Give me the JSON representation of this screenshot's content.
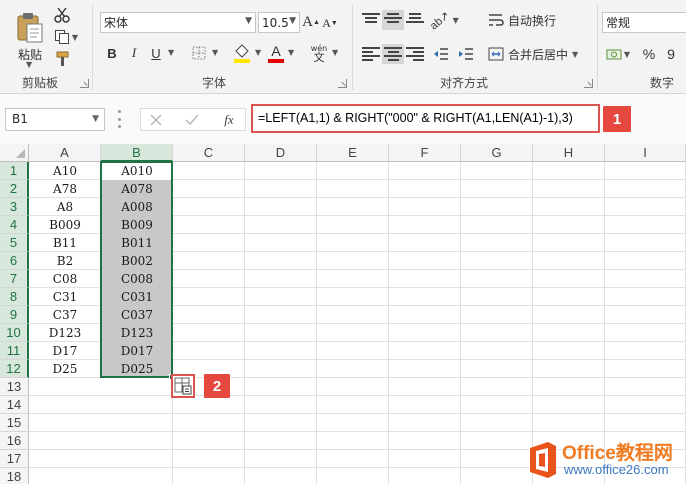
{
  "ribbon": {
    "clipboard": {
      "paste_label": "粘贴",
      "group_label": "剪贴板"
    },
    "font": {
      "name": "宋体",
      "size": "10.5",
      "bold": "B",
      "italic": "I",
      "underline": "U",
      "grow": "A",
      "shrink": "A",
      "group_label": "字体",
      "phonetic": "wén"
    },
    "alignment": {
      "wrap_text": "自动换行",
      "merge_center": "合并后居中",
      "group_label": "对齐方式"
    },
    "number": {
      "format": "常规",
      "percent": "%",
      "comma": "9",
      "group_label": "数字"
    }
  },
  "formula_bar": {
    "name_box": "B1",
    "fx": "fx",
    "formula": "=LEFT(A1,1) & RIGHT(\"000\" & RIGHT(A1,LEN(A1)-1),3)",
    "badge_1": "1"
  },
  "grid": {
    "columns": [
      "A",
      "B",
      "C",
      "D",
      "E",
      "F",
      "G",
      "H",
      "I"
    ],
    "rows": [
      "1",
      "2",
      "3",
      "4",
      "5",
      "6",
      "7",
      "8",
      "9",
      "10",
      "11",
      "12",
      "13",
      "14",
      "15",
      "16",
      "17",
      "18"
    ],
    "col_a": [
      "A10",
      "A78",
      "A8",
      "B009",
      "B11",
      "B2",
      "C08",
      "C31",
      "C37",
      "D123",
      "D17",
      "D25"
    ],
    "col_b": [
      "A010",
      "A078",
      "A008",
      "B009",
      "B011",
      "B002",
      "C008",
      "C031",
      "C037",
      "D123",
      "D017",
      "D025"
    ],
    "badge_2": "2"
  },
  "watermark": {
    "brand": "Office教程网",
    "url": "www.office26.com"
  },
  "colors": {
    "accent_green": "#217346",
    "badge_red": "#e5483f",
    "selection_gray": "#c8c8c8"
  }
}
